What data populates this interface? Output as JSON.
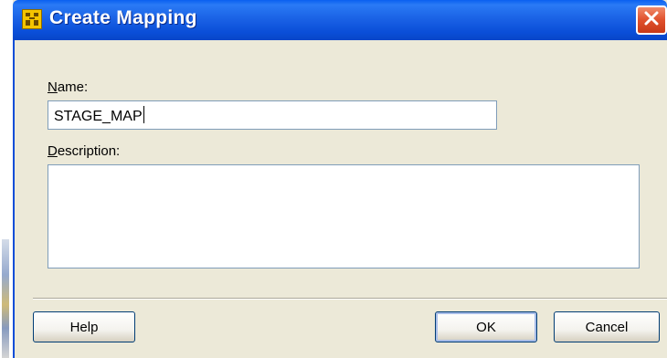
{
  "window": {
    "title": "Create Mapping",
    "title_bar_color": "#0a4ed8",
    "title_icon": "mapping-icon",
    "close_icon": "close-icon"
  },
  "form": {
    "name_label_mnemonic": "N",
    "name_label_rest": "ame:",
    "name_value": "STAGE_MAP",
    "description_label_mnemonic": "D",
    "description_label_rest": "escription:",
    "description_value": ""
  },
  "buttons": {
    "help_mnemonic": "H",
    "help_rest": "elp",
    "ok_label": "OK",
    "cancel_label": "Cancel"
  }
}
